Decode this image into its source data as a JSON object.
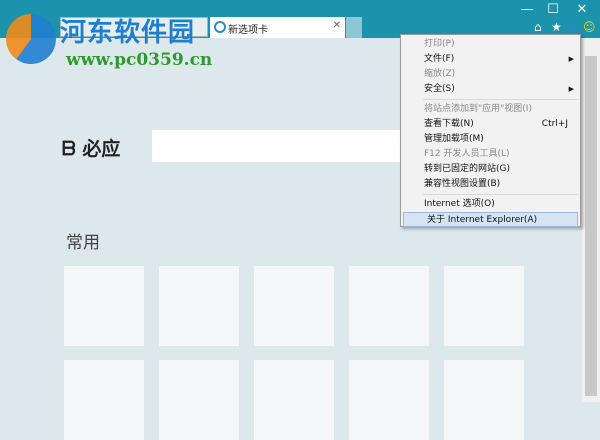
{
  "window": {
    "minimize": "—",
    "maximize": "☐",
    "close": "✕"
  },
  "tab": {
    "label": "新选项卡",
    "close": "✕"
  },
  "toolbar": {
    "home": "⌂",
    "favorites": "★",
    "tools": "⚙",
    "feedback": "☺"
  },
  "watermark": {
    "name": "河东软件园",
    "url": "www.pc0359.cn"
  },
  "page": {
    "bing_label": "必应",
    "section_title": "常用"
  },
  "menu": {
    "items": [
      {
        "label": "打印(P)",
        "disabled": true
      },
      {
        "label": "文件(F)",
        "submenu": true
      },
      {
        "label": "缩放(Z)",
        "disabled": true
      },
      {
        "label": "安全(S)",
        "submenu": true
      },
      {
        "sep": true
      },
      {
        "label": "将站点添加到\"应用\"视图(I)",
        "disabled": true
      },
      {
        "label": "查看下载(N)",
        "shortcut": "Ctrl+J"
      },
      {
        "label": "管理加载项(M)"
      },
      {
        "label": "F12 开发人员工具(L)",
        "disabled": true
      },
      {
        "label": "转到已固定的网站(G)"
      },
      {
        "label": "兼容性视图设置(B)"
      },
      {
        "sep": true
      },
      {
        "label": "Internet 选项(O)"
      },
      {
        "label": "关于 Internet Explorer(A)",
        "highlighted": true
      }
    ]
  }
}
